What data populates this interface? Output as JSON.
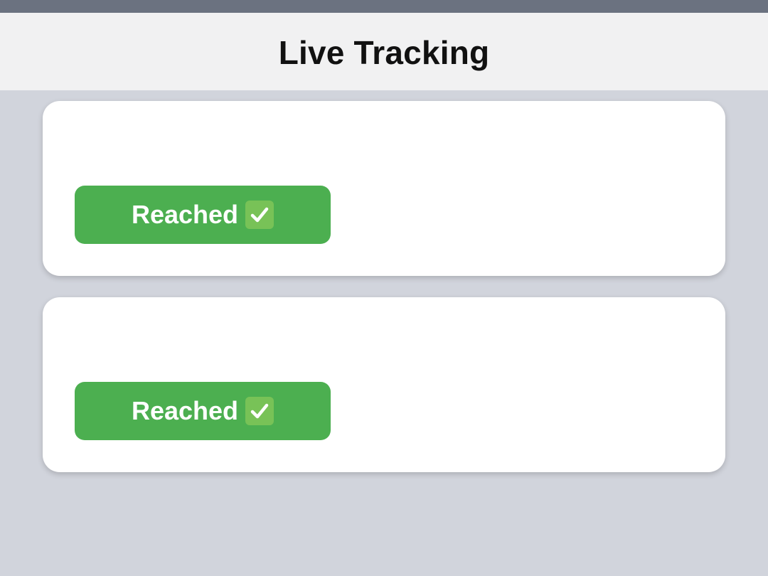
{
  "header": {
    "title": "Live Tracking"
  },
  "cards": [
    {
      "status_label": "Reached",
      "status_icon": "check-mark-icon",
      "status_color": "#4caf50"
    },
    {
      "status_label": "Reached",
      "status_icon": "check-mark-icon",
      "status_color": "#4caf50"
    }
  ],
  "colors": {
    "status_bar": "#6b7280",
    "header_bg": "#f1f1f2",
    "page_bg": "#d1d4dc",
    "card_bg": "#ffffff",
    "success": "#4caf50"
  }
}
